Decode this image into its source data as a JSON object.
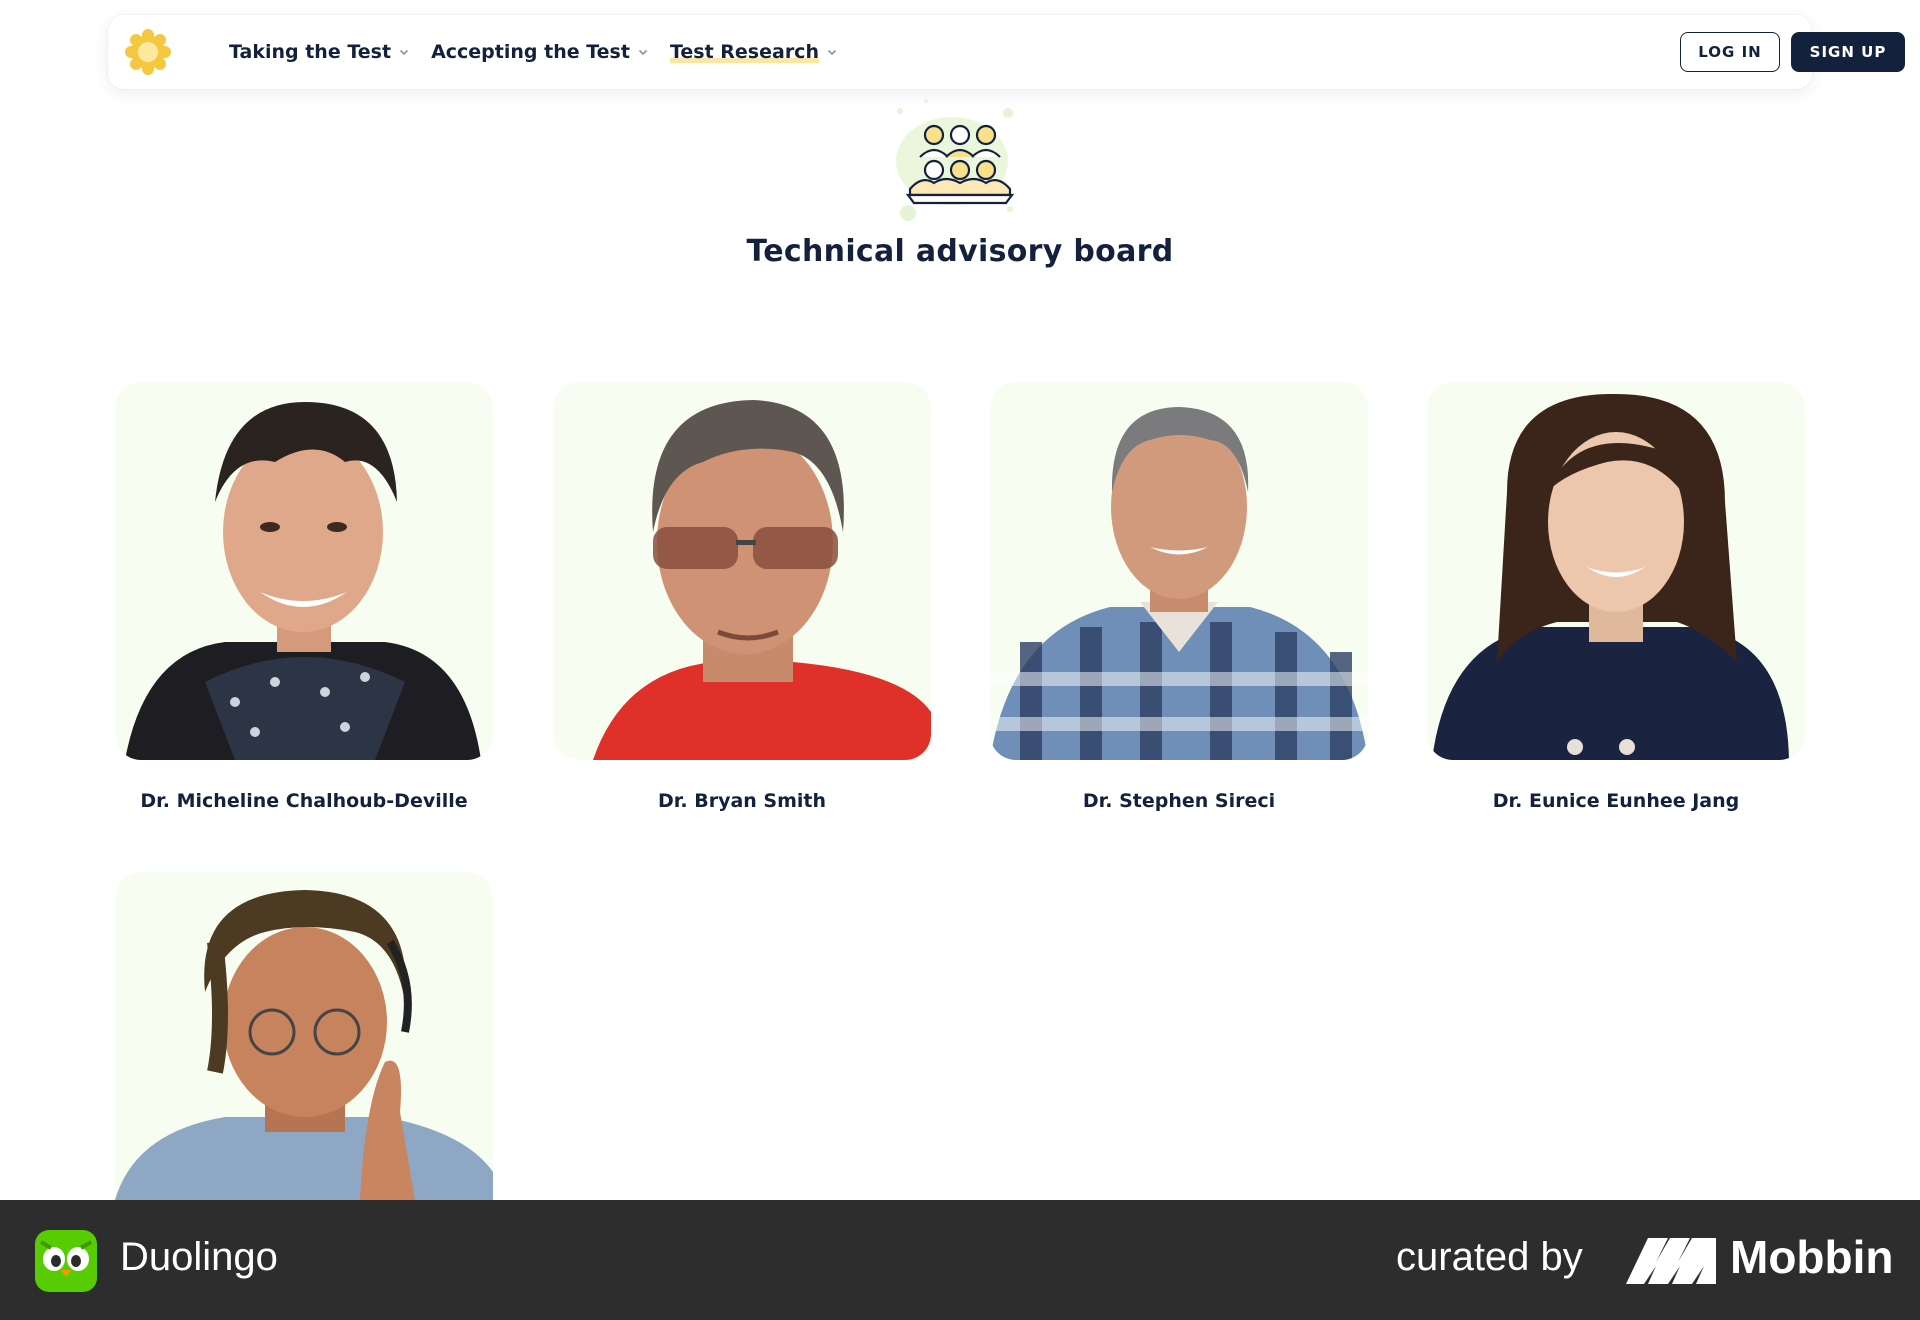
{
  "nav": {
    "logo_name": "test-logo",
    "items": [
      {
        "label": "Taking the Test",
        "icon": "chevron-down-icon"
      },
      {
        "label": "Accepting the Test",
        "icon": "chevron-down-icon"
      },
      {
        "label": "Test Research",
        "icon": "chevron-down-icon",
        "active": true
      }
    ],
    "login_label": "LOG IN",
    "signup_label": "SIGN UP"
  },
  "section": {
    "icon": "advisory-board-icon",
    "title": "Technical advisory board"
  },
  "members": [
    {
      "name": "Dr. Micheline Chalhoub-Deville"
    },
    {
      "name": "Dr. Bryan Smith"
    },
    {
      "name": "Dr. Stephen Sireci"
    },
    {
      "name": "Dr. Eunice Eunhee Jang"
    },
    {
      "name": ""
    }
  ],
  "footer": {
    "app_name": "Duolingo",
    "curated_by": "curated by",
    "brand": "Mobbin"
  },
  "colors": {
    "navy": "#14213d",
    "card_bg": "#f8fdf1",
    "footer_bg": "#2d2d2d",
    "accent_yellow": "#f5c842",
    "duolingo_green": "#58cc02"
  }
}
